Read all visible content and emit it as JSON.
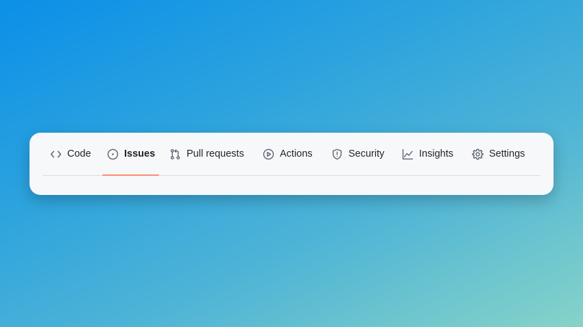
{
  "nav": {
    "tabs": [
      {
        "label": "Code",
        "icon": "code-icon"
      },
      {
        "label": "Issues",
        "icon": "issue-opened-icon",
        "selected": true
      },
      {
        "label": "Pull requests",
        "icon": "git-pull-request-icon"
      },
      {
        "label": "Actions",
        "icon": "play-icon"
      },
      {
        "label": "Security",
        "icon": "shield-icon"
      },
      {
        "label": "Insights",
        "icon": "graph-icon"
      },
      {
        "label": "Settings",
        "icon": "gear-icon"
      }
    ],
    "accent_color": "#fd8c73"
  }
}
